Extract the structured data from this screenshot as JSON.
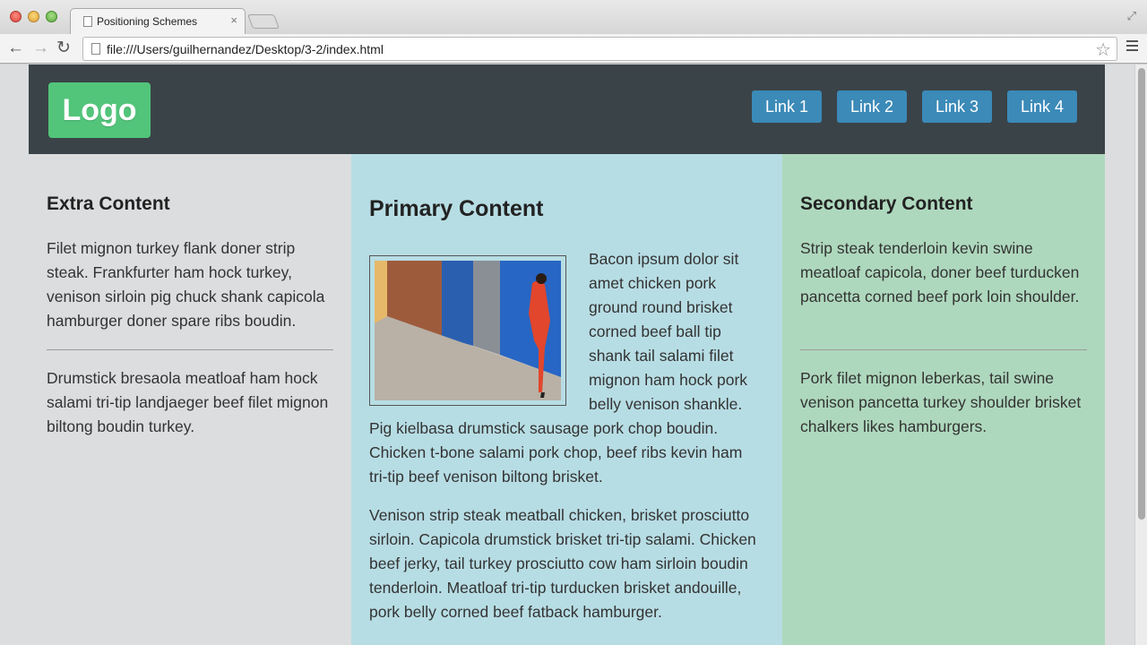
{
  "browser": {
    "tab_title": "Positioning Schemes",
    "tab_close": "×",
    "url": "file:///Users/guilhernandez/Desktop/3-2/index.html"
  },
  "header": {
    "logo": "Logo",
    "links": [
      "Link 1",
      "Link 2",
      "Link 3",
      "Link 4"
    ]
  },
  "extra": {
    "heading": "Extra Content",
    "p1": "Filet mignon turkey flank doner strip steak. Frankfurter ham hock turkey, venison sirloin pig chuck shank capicola hamburger doner spare ribs boudin.",
    "p2": "Drumstick bresaola meatloaf ham hock salami tri-tip landjaeger beef filet mignon biltong boudin turkey."
  },
  "primary": {
    "heading": "Primary Content",
    "p1": "Bacon ipsum dolor sit amet chicken pork ground round brisket corned beef ball tip shank tail salami filet mignon ham hock pork belly venison shankle. Pig kielbasa drumstick sausage pork chop boudin. Chicken t-bone salami pork chop, beef ribs kevin ham tri-tip beef venison biltong brisket.",
    "p2": "Venison strip steak meatball chicken, brisket prosciutto sirloin. Capicola drumstick brisket tri-tip salami. Chicken beef jerky, tail turkey prosciutto cow ham sirloin boudin tenderloin. Meatloaf tri-tip turducken brisket andouille, pork belly corned beef fatback hamburger."
  },
  "secondary": {
    "heading": "Secondary Content",
    "p1": "Strip steak tenderloin kevin swine meatloaf capicola, doner beef turducken pancetta corned beef pork loin shoulder.",
    "p2": "Pork filet mignon leberkas, tail swine venison pancetta turkey shoulder brisket chalkers likes hamburgers."
  },
  "colors": {
    "header_bg": "#3a4348",
    "logo_bg": "#52c57a",
    "link_bg": "#3b8ab8",
    "primary_bg": "#b7dde4",
    "secondary_bg": "#aed8bd"
  }
}
